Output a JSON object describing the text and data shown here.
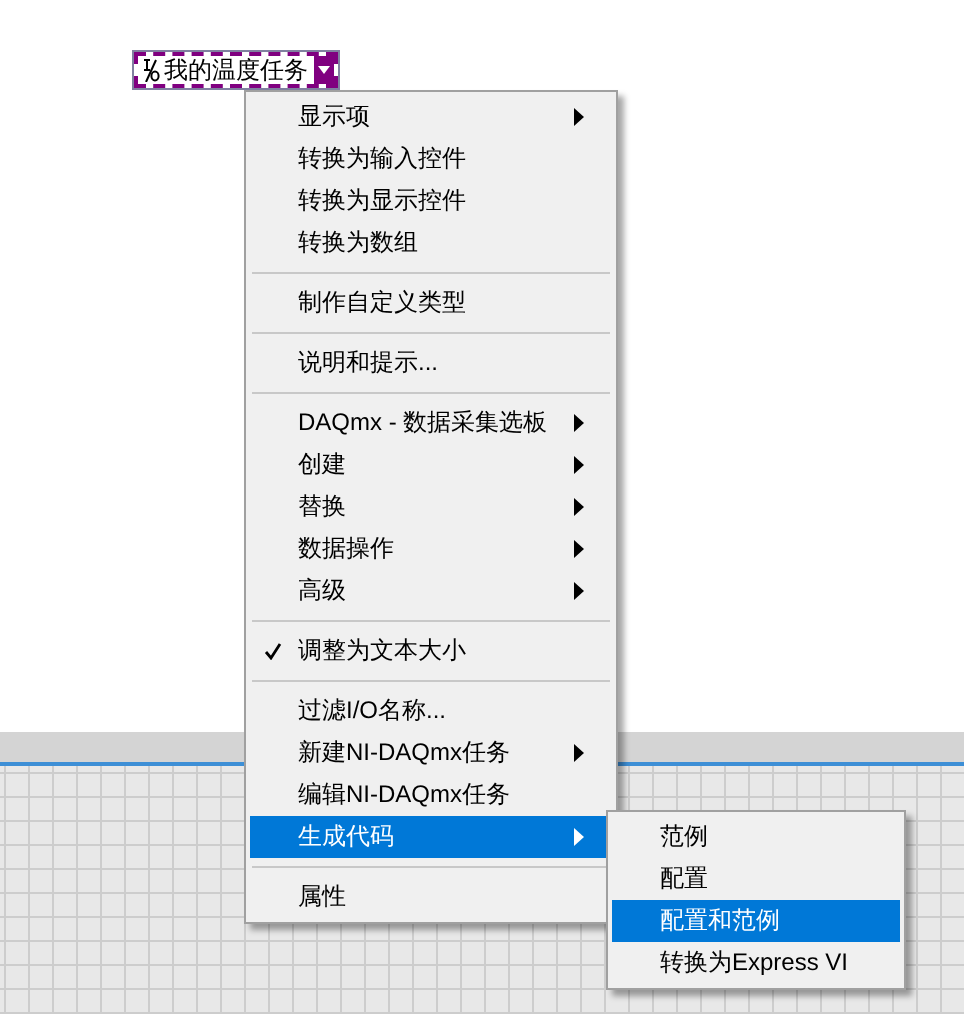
{
  "control": {
    "label": "我的温度任务"
  },
  "menu": [
    {
      "kind": "item",
      "label": "显示项",
      "submenu": true,
      "checked": false,
      "selected": false
    },
    {
      "kind": "item",
      "label": "转换为输入控件",
      "submenu": false,
      "checked": false,
      "selected": false
    },
    {
      "kind": "item",
      "label": "转换为显示控件",
      "submenu": false,
      "checked": false,
      "selected": false
    },
    {
      "kind": "item",
      "label": "转换为数组",
      "submenu": false,
      "checked": false,
      "selected": false
    },
    {
      "kind": "separator"
    },
    {
      "kind": "item",
      "label": "制作自定义类型",
      "submenu": false,
      "checked": false,
      "selected": false
    },
    {
      "kind": "separator"
    },
    {
      "kind": "item",
      "label": "说明和提示...",
      "submenu": false,
      "checked": false,
      "selected": false
    },
    {
      "kind": "separator"
    },
    {
      "kind": "item",
      "label": "DAQmx - 数据采集选板",
      "submenu": true,
      "checked": false,
      "selected": false
    },
    {
      "kind": "item",
      "label": "创建",
      "submenu": true,
      "checked": false,
      "selected": false
    },
    {
      "kind": "item",
      "label": "替换",
      "submenu": true,
      "checked": false,
      "selected": false
    },
    {
      "kind": "item",
      "label": "数据操作",
      "submenu": true,
      "checked": false,
      "selected": false
    },
    {
      "kind": "item",
      "label": "高级",
      "submenu": true,
      "checked": false,
      "selected": false
    },
    {
      "kind": "separator"
    },
    {
      "kind": "item",
      "label": "调整为文本大小",
      "submenu": false,
      "checked": true,
      "selected": false
    },
    {
      "kind": "separator"
    },
    {
      "kind": "item",
      "label": "过滤I/O名称...",
      "submenu": false,
      "checked": false,
      "selected": false
    },
    {
      "kind": "item",
      "label": "新建NI-DAQmx任务",
      "submenu": true,
      "checked": false,
      "selected": false
    },
    {
      "kind": "item",
      "label": "编辑NI-DAQmx任务",
      "submenu": false,
      "checked": false,
      "selected": false
    },
    {
      "kind": "item",
      "label": "生成代码",
      "submenu": true,
      "checked": false,
      "selected": true
    },
    {
      "kind": "separator"
    },
    {
      "kind": "item",
      "label": "属性",
      "submenu": false,
      "checked": false,
      "selected": false
    }
  ],
  "submenu": [
    {
      "label": "范例",
      "selected": false
    },
    {
      "label": "配置",
      "selected": false
    },
    {
      "label": "配置和范例",
      "selected": true
    },
    {
      "label": "转换为Express VI",
      "selected": false
    }
  ]
}
